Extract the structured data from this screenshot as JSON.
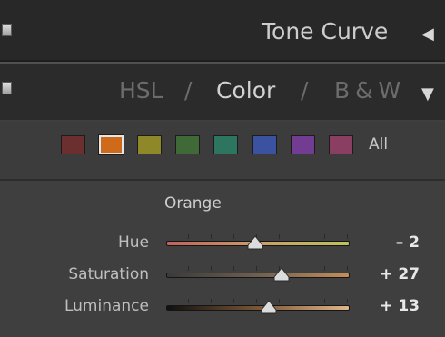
{
  "tone_curve": {
    "title": "Tone Curve",
    "collapse_icon": "triangle-left-icon"
  },
  "hsl": {
    "tab_hsl": "HSL",
    "sep1": "/",
    "tab_color": "Color",
    "sep2": "/",
    "tab_bw": "B & W",
    "expand_icon": "triangle-down-icon"
  },
  "swatches": [
    {
      "name": "red",
      "color": "#6b2f2f"
    },
    {
      "name": "orange",
      "color": "#cf6a1a"
    },
    {
      "name": "yellow",
      "color": "#8f8828"
    },
    {
      "name": "green",
      "color": "#3f6a38"
    },
    {
      "name": "aqua",
      "color": "#2e7560"
    },
    {
      "name": "blue",
      "color": "#3a52a0"
    },
    {
      "name": "purple",
      "color": "#733c93"
    },
    {
      "name": "magenta",
      "color": "#8a3f62"
    }
  ],
  "all_label": "All",
  "section": {
    "title": "Orange",
    "sliders": [
      {
        "label": "Hue",
        "value_text": "– 2",
        "value": -2,
        "min": -100,
        "max": 100
      },
      {
        "label": "Saturation",
        "value_text": "+ 27",
        "value": 27,
        "min": -100,
        "max": 100
      },
      {
        "label": "Luminance",
        "value_text": "+ 13",
        "value": 13,
        "min": -100,
        "max": 100
      }
    ]
  }
}
